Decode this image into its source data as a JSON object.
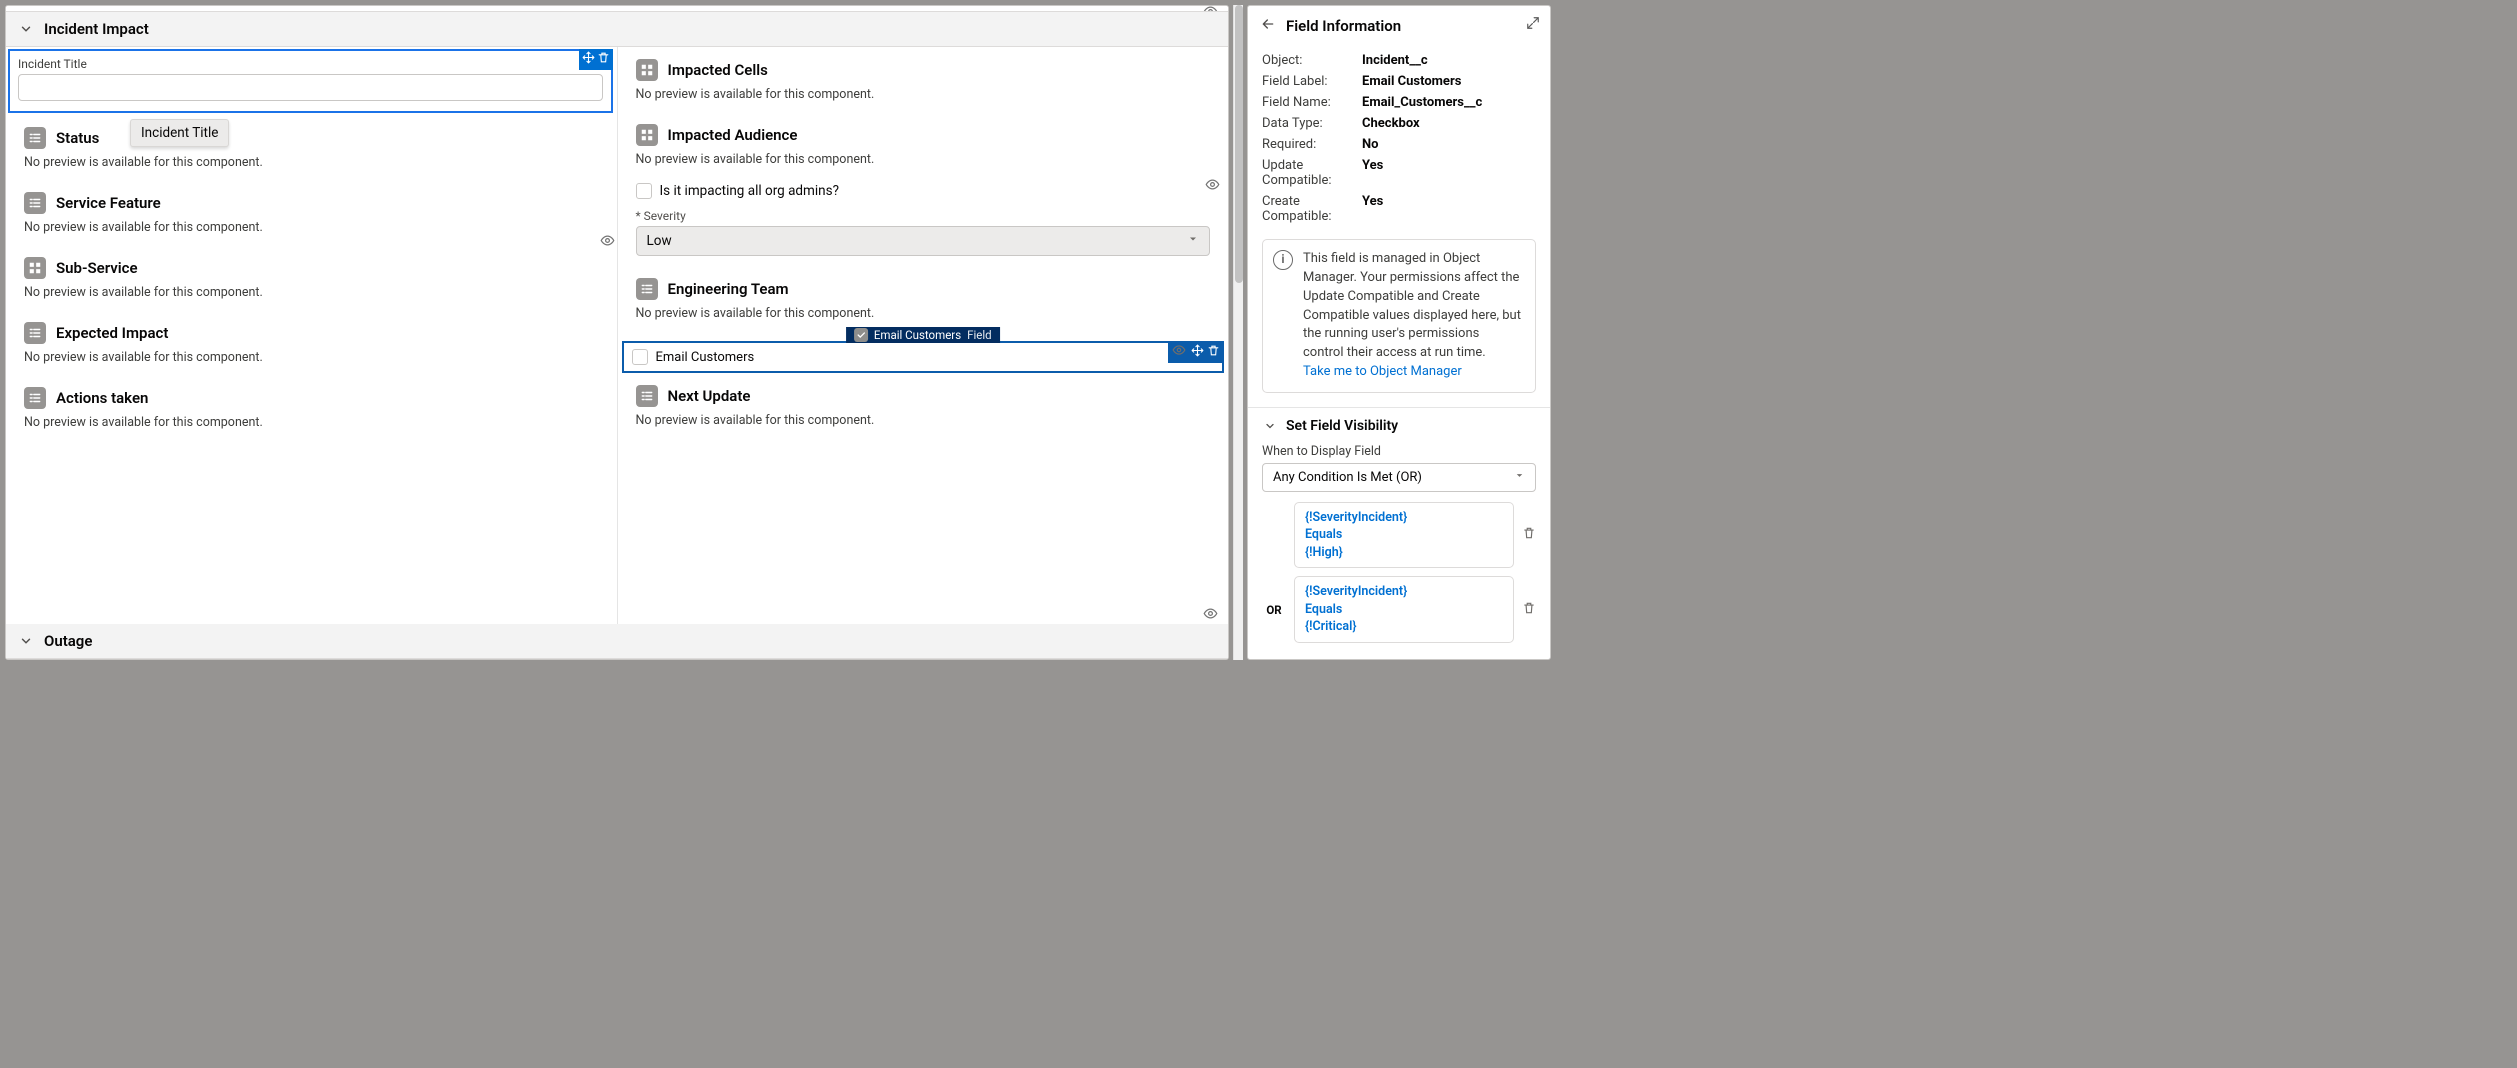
{
  "sections": {
    "impact_title": "Incident Impact",
    "outage_title": "Outage"
  },
  "tooltip": "Incident Title",
  "left": {
    "incident_title_label": "Incident Title",
    "items": [
      {
        "label": "Status",
        "sub": "No preview is available for this component."
      },
      {
        "label": "Service Feature",
        "sub": "No preview is available for this component."
      },
      {
        "label": "Sub-Service",
        "sub": "No preview is available for this component."
      },
      {
        "label": "Expected Impact",
        "sub": "No preview is available for this component."
      },
      {
        "label": "Actions taken",
        "sub": "No preview is available for this component."
      }
    ]
  },
  "right": {
    "cells": {
      "label": "Impacted Cells",
      "sub": "No preview is available for this component."
    },
    "audience": {
      "label": "Impacted Audience",
      "sub": "No preview is available for this component."
    },
    "impacting_label": "Is it impacting all org admins?",
    "severity_req": "* Severity",
    "severity_value": "Low",
    "eng": {
      "label": "Engineering Team",
      "sub": "No preview is available for this component."
    },
    "ec_tag_label": "Email Customers",
    "ec_tag_type": "Field",
    "ec_label": "Email Customers",
    "next": {
      "label": "Next Update",
      "sub": "No preview is available for this component."
    }
  },
  "sidebar": {
    "title": "Field Information",
    "kv": [
      {
        "k": "Object:",
        "v": "Incident__c"
      },
      {
        "k": "Field Label:",
        "v": "Email Customers"
      },
      {
        "k": "Field Name:",
        "v": "Email_Customers__c"
      },
      {
        "k": "Data Type:",
        "v": "Checkbox"
      },
      {
        "k": "Required:",
        "v": "No"
      },
      {
        "k": "Update Compatible:",
        "v": "Yes"
      },
      {
        "k": "Create Compatible:",
        "v": "Yes"
      }
    ],
    "info_text": "This field is managed in Object Manager. Your permissions affect the Update Compatible and Create Compatible values displayed here, but the running user's permissions control their access at run time.",
    "info_link": "Take me to Object Manager",
    "visibility_header": "Set Field Visibility",
    "when_label": "When to Display Field",
    "when_value": "Any Condition Is Met (OR)",
    "or_label": "OR",
    "conds": [
      {
        "l1": "{!SeverityIncident}",
        "l2": "Equals",
        "l3": "{!High}"
      },
      {
        "l1": "{!SeverityIncident}",
        "l2": "Equals",
        "l3": "{!Critical}"
      }
    ]
  }
}
